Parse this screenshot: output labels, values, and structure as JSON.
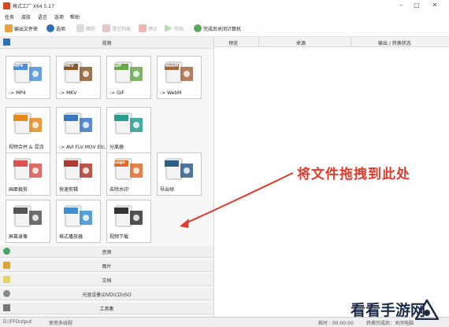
{
  "window": {
    "title": "格式工厂 X64 5.17"
  },
  "menu": [
    "任务",
    "皮肤",
    "语言",
    "选项",
    "帮助"
  ],
  "toolbar": {
    "output_folder": "输出文件夹",
    "options": "选项",
    "remove": "移除",
    "clear_list": "清空列表",
    "stop": "停止",
    "start": "开始",
    "shutdown": "完成后关闭计算机"
  },
  "sections": {
    "video": "视频",
    "audio": "音频",
    "image": "图片",
    "document": "文档",
    "disc": "光驱设备\\DVD\\CD\\ISO",
    "toolbox": "工具集"
  },
  "video_tiles": [
    {
      "label": "-> MP4",
      "badge": "MP4",
      "color": "#4d8fd8"
    },
    {
      "label": "-> MKV",
      "badge": "MKV",
      "color": "#8b5a2b"
    },
    {
      "label": "-> GIF",
      "badge": "GIF",
      "color": "#6aa84f"
    },
    {
      "label": "-> WebM",
      "badge": "WebM",
      "color": "#a5673f"
    },
    {
      "label": "视频合并 & 混流",
      "badge": "",
      "color": "#e38b1e"
    },
    {
      "label": "-> AVI FLV\nMOV Etc...",
      "badge": "",
      "color": "#3b78c2"
    },
    {
      "label": "分离器",
      "badge": "",
      "color": "#2a9d8f"
    },
    {
      "label": "画面裁剪",
      "badge": "",
      "color": "#d9534f"
    },
    {
      "label": "快速剪辑",
      "badge": "",
      "color": "#b03a2e"
    },
    {
      "label": "去除水印",
      "badge": "Logo",
      "color": "#e06a2a"
    },
    {
      "label": "导出帧",
      "badge": "",
      "color": "#2f5d8a"
    },
    {
      "label": "屏幕录像",
      "badge": "",
      "color": "#555555"
    },
    {
      "label": "格式播放器",
      "badge": "",
      "color": "#3d8fd1"
    },
    {
      "label": "视频下载",
      "badge": "",
      "color": "#333333"
    }
  ],
  "list_columns": {
    "preview": "预览",
    "source": "来源",
    "output": "输出 / 转换状态"
  },
  "drop_hint": "将文件拖拽到此处",
  "status": {
    "output_path": "D:\\FFOutput",
    "multithread": "使用多线程",
    "elapsed": "耗时 : 00:00:00",
    "shutdown_after": "转换完成后：关闭电脑"
  },
  "watermark": "看看手游网",
  "colors": {
    "accent": "#e03b2a",
    "tile_border": "#c9c9c9"
  }
}
